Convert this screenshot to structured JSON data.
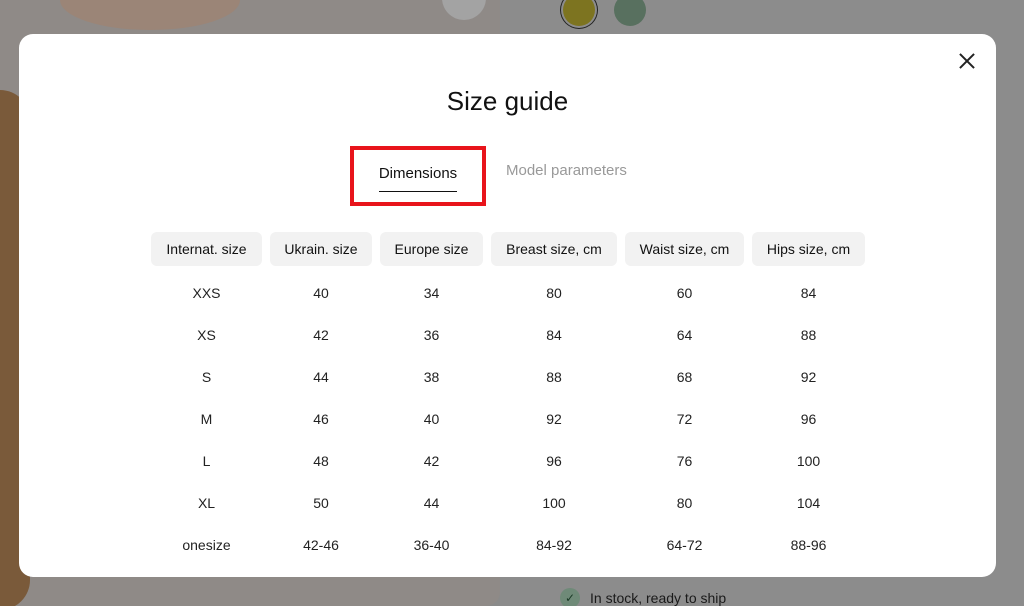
{
  "modal": {
    "title": "Size guide",
    "tabs": [
      {
        "label": "Dimensions",
        "active": true
      },
      {
        "label": "Model parameters",
        "active": false
      }
    ],
    "table": {
      "headers": [
        "Internat. size",
        "Ukrain. size",
        "Europe size",
        "Breast size, cm",
        "Waist size, cm",
        "Hips size, cm"
      ],
      "rows": [
        [
          "XXS",
          "40",
          "34",
          "80",
          "60",
          "84"
        ],
        [
          "XS",
          "42",
          "36",
          "84",
          "64",
          "88"
        ],
        [
          "S",
          "44",
          "38",
          "88",
          "68",
          "92"
        ],
        [
          "M",
          "46",
          "40",
          "92",
          "72",
          "96"
        ],
        [
          "L",
          "48",
          "42",
          "96",
          "76",
          "100"
        ],
        [
          "XL",
          "50",
          "44",
          "100",
          "80",
          "104"
        ],
        [
          "onesize",
          "42-46",
          "36-40",
          "84-92",
          "64-72",
          "88-96"
        ]
      ]
    },
    "close_icon": "close-icon"
  },
  "background": {
    "stock_text": "In stock, ready to ship",
    "swatches": [
      "#7d7420",
      "#58705f"
    ]
  },
  "colors": {
    "highlight": "#e8141b",
    "header_bg": "#f2f2f2",
    "inactive_tab": "#999999"
  }
}
